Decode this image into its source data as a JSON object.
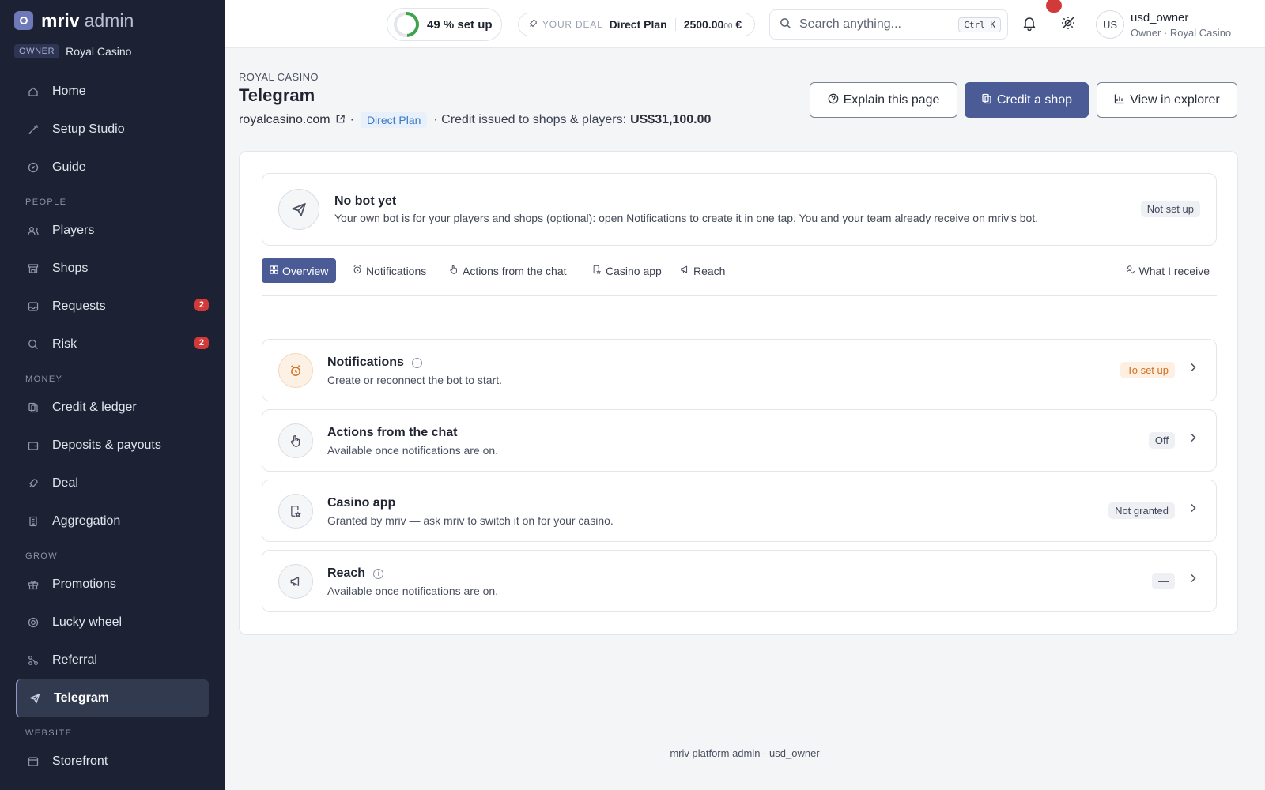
{
  "brand": {
    "name": "mriv",
    "suffix": "admin",
    "role_pill": "OWNER",
    "org": "Royal Casino"
  },
  "sidebar": {
    "top_items": [
      {
        "label": "Home",
        "icon": "home-icon"
      },
      {
        "label": "Setup Studio",
        "icon": "wand-icon"
      },
      {
        "label": "Guide",
        "icon": "compass-icon"
      }
    ],
    "sections": [
      {
        "label": "PEOPLE",
        "items": [
          {
            "label": "Players",
            "icon": "users-icon"
          },
          {
            "label": "Shops",
            "icon": "store-icon"
          },
          {
            "label": "Requests",
            "icon": "inbox-icon",
            "badge": "2"
          },
          {
            "label": "Risk",
            "icon": "search-alert-icon",
            "badge": "2"
          }
        ]
      },
      {
        "label": "MONEY",
        "items": [
          {
            "label": "Credit & ledger",
            "icon": "ledger-icon"
          },
          {
            "label": "Deposits & payouts",
            "icon": "wallet-icon"
          },
          {
            "label": "Deal",
            "icon": "rocket-icon"
          },
          {
            "label": "Aggregation",
            "icon": "building-icon"
          }
        ]
      },
      {
        "label": "GROW",
        "items": [
          {
            "label": "Promotions",
            "icon": "gift-icon"
          },
          {
            "label": "Lucky wheel",
            "icon": "wheel-icon"
          },
          {
            "label": "Referral",
            "icon": "network-icon"
          },
          {
            "label": "Telegram",
            "icon": "send-icon",
            "active": true
          }
        ]
      },
      {
        "label": "WEBSITE",
        "items": [
          {
            "label": "Storefront",
            "icon": "browser-icon"
          }
        ]
      }
    ]
  },
  "topbar": {
    "setup_progress": 0.49,
    "setup_label": "49 % set up",
    "deal_label": "YOUR DEAL",
    "deal_plan": "Direct Plan",
    "deal_amount_main": "2500.00",
    "deal_amount_small": "00",
    "deal_currency": "€",
    "search_placeholder": "Search anything...",
    "search_shortcut": "Ctrl K",
    "avatar_initials": "US",
    "user_name": "usd_owner",
    "user_role": "Owner · Royal Casino"
  },
  "header": {
    "eyebrow": "ROYAL CASINO",
    "title": "Telegram",
    "site": "royalcasino.com",
    "sep": "·",
    "plan": "Direct Plan",
    "credit_text": "· Credit issued to shops & players:",
    "credit_value": "US$31,100.00",
    "buttons": {
      "explain": "Explain this page",
      "credit": "Credit a shop",
      "explorer": "View in explorer"
    }
  },
  "bot": {
    "title": "No bot yet",
    "desc": "Your own bot is for your players and shops (optional): open Notifications to create it in one tap. You and your team already receive on mriv's bot.",
    "status": "Not set up"
  },
  "tabs": {
    "items": [
      "Overview",
      "Notifications",
      "Actions from the chat",
      "Casino app",
      "Reach"
    ],
    "right": "What I receive"
  },
  "features": [
    {
      "title": "Notifications",
      "desc": "Create or reconnect the bot to start.",
      "status": "To set up",
      "info": true
    },
    {
      "title": "Actions from the chat",
      "desc": "Available once notifications are on.",
      "status": "Off",
      "info": false
    },
    {
      "title": "Casino app",
      "desc": "Granted by mriv — ask mriv to switch it on for your casino.",
      "status": "Not granted",
      "info": false
    },
    {
      "title": "Reach",
      "desc": "Available once notifications are on.",
      "status": "—",
      "info": true
    }
  ],
  "footer": "mriv platform admin · usd_owner",
  "colors": {
    "sidebar_bg": "#1c2233",
    "primary": "#4b5b95",
    "badge": "#d23a3a",
    "progress": "#3fa34d",
    "warn": "#d1701e"
  }
}
